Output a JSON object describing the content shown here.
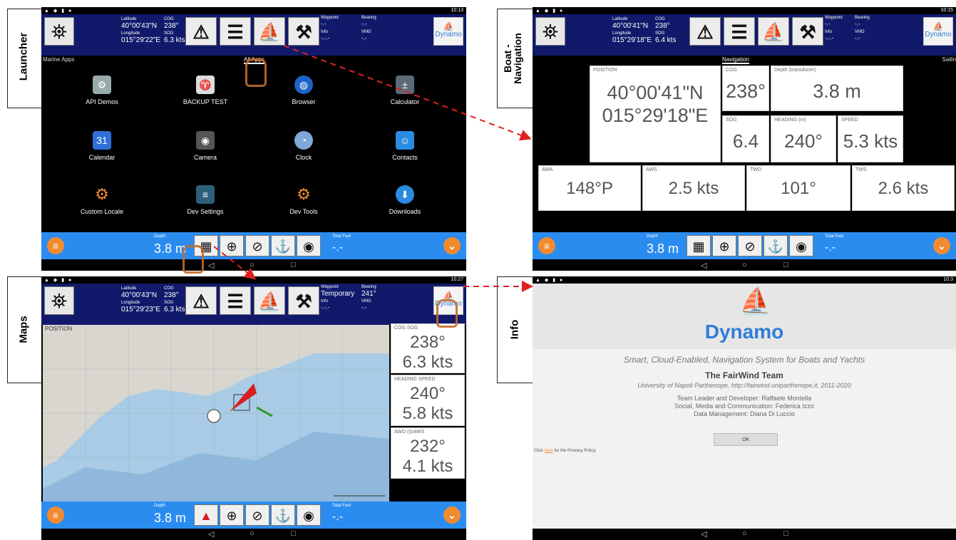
{
  "labels": {
    "launcher": "Launcher",
    "boat": "Boat -\nNavigation",
    "maps": "Maps",
    "info": "Info"
  },
  "launcher": {
    "time": "10:13",
    "lat_k": "Latitude",
    "lat": "40°00'43\"N",
    "lon_k": "Longitude",
    "lon": "015°29'22\"E",
    "cog_k": "COG",
    "cog": "238°",
    "sog_k": "SOG",
    "sog": "6.3 kts",
    "wp_k": "Waypoint",
    "wp": "-.-",
    "brg_k": "Bearing",
    "brg": "-.-",
    "info_k": "Info",
    "info": "-.-.-",
    "vmg_k": "VMG",
    "vmg": "-.-",
    "tab_left": "Marine Apps",
    "tab_center": "All Apps",
    "apps": [
      "API Demos",
      "BACKUP TEST",
      "Browser",
      "Calculator",
      "Calendar",
      "Camera",
      "Clock",
      "Contacts",
      "Custom Locale",
      "Dev Settings",
      "Dev Tools",
      "Downloads"
    ],
    "depth_k": "Depth",
    "depth": "3.8 m",
    "fuel_k": "Total Fuel",
    "fuel": "-.-"
  },
  "boat": {
    "time": "10:15",
    "lat_k": "Latitude",
    "lat": "40°00'41\"N",
    "lon_k": "Longitude",
    "lon": "015°29'18\"E",
    "cog_k": "COG",
    "cog": "238°",
    "sog_k": "SOG",
    "sog": "6.4 kts",
    "wp_k": "Waypoint",
    "wp": "-.-",
    "brg_k": "Bearing",
    "brg": "-.-",
    "info_k": "Info",
    "info": "-.-.-",
    "vmg_k": "VMG",
    "vmg": "-.-",
    "tab_center": "Navigation",
    "tab_right": "Sailin",
    "pos_t": "POSITION",
    "pos1": "40°00'41\"N",
    "pos2": "015°29'18\"E",
    "cog_t": "COG",
    "cog_v": "238°",
    "depth_t": "Depth (transducer)",
    "depth_v": "3.8 m",
    "sog_t": "SOG",
    "sog_v": "6.4",
    "head_t": "HEADING (m)",
    "head_v": "240°",
    "speed_t": "SPEED",
    "speed_v": "5.3 kts",
    "awa_t": "AWA",
    "awa_v": "148°P",
    "aws_t": "AWS",
    "aws_v": "2.5 kts",
    "twd_t": "TWD",
    "twd_v": "101°",
    "tws_t": "TWS",
    "tws_v": "2.6 kts",
    "depth_k": "Depth",
    "depth": "3.8 m",
    "fuel_k": "Total Fuel",
    "fuel": "-.-"
  },
  "maps": {
    "time": "10:27",
    "lat_k": "Latitude",
    "lat": "40°00'43\"N",
    "lon_k": "Longitude",
    "lon": "015°29'23\"E",
    "cog_k": "COG",
    "cog": "238°",
    "sog_k": "SOG",
    "sog": "6.3 kts",
    "wp_k": "Waypoint",
    "wp": "Temporary",
    "brg_k": "Bearing",
    "brg": "241°",
    "info_k": "Info",
    "info": "-.-.-",
    "vmg_k": "VMG",
    "vmg": "-.-",
    "pos_t": "POSITION",
    "c1_t": "COG SOG",
    "c1_a": "238°",
    "c1_b": "6.3 kts",
    "c2_t": "HEADING SPEED",
    "c2_a": "240°",
    "c2_b": "5.8 kts",
    "c3_t": "AWD (t)/AWS",
    "c3_a": "232°",
    "c3_b": "4.1 kts",
    "depth_k": "Depth",
    "depth": "3.8 m",
    "fuel_k": "Total Fuel",
    "fuel": "-.-"
  },
  "info": {
    "time": "10:3",
    "brand": "Dynamo",
    "tagline": "Smart, Cloud-Enabled, Navigation System for Boats and Yachts",
    "team": "The FairWind Team",
    "uni": "University of Napoli Parthenope, http://fairwind.uniparthenope.it, 2011-2020",
    "l1": "Team Leader and Developer: Raffaele Montella",
    "l2": "Social, Media and Communication: Federica Izzo",
    "l3": "Data Management: Diana Di Luccio",
    "ok": "OK",
    "privacy_pre": "Click ",
    "privacy_link": "here",
    "privacy_post": " for the Provacy Policy."
  },
  "dynamo_label": "Dynamo",
  "nav_glyphs": {
    "back": "◁",
    "home": "○",
    "recent": "□"
  }
}
